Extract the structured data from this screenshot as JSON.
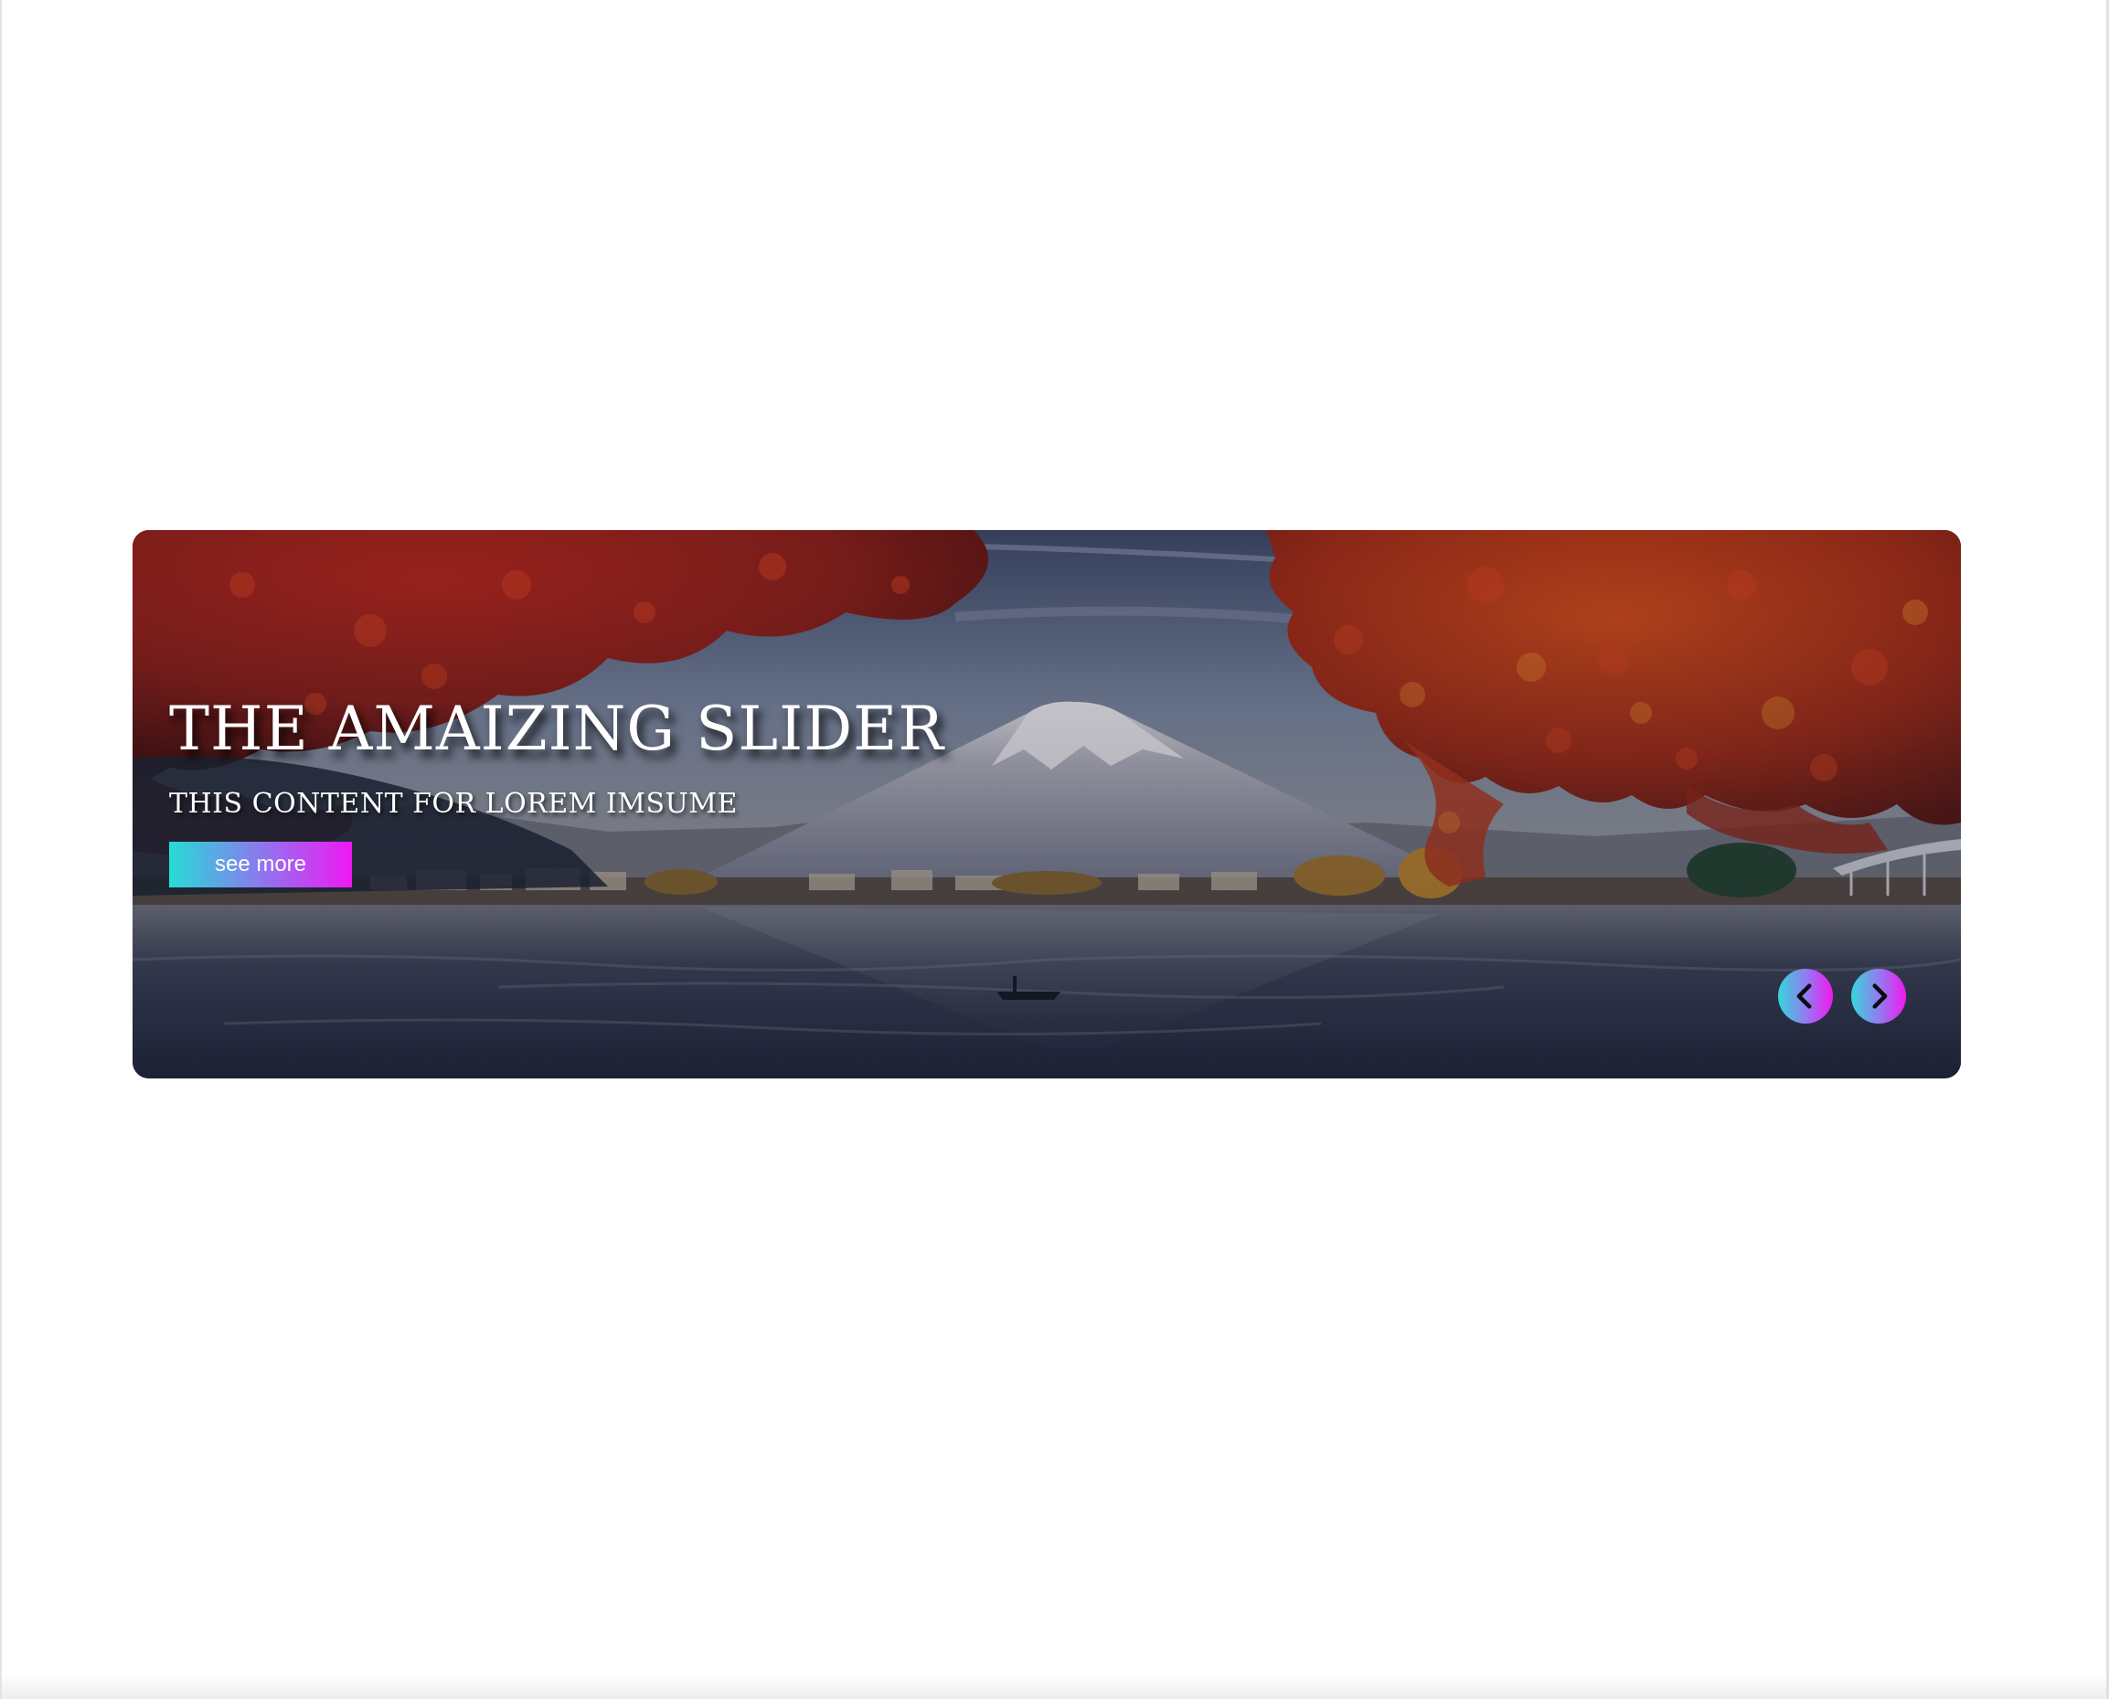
{
  "slider": {
    "title": "THE AMAIZING SLIDER",
    "subtitle": "THIS CONTENT FOR LOREM IMSUME",
    "cta_label": "see more",
    "image": "autumn lake mountain landscape",
    "prev_icon": "chevron-left-icon",
    "next_icon": "chevron-right-icon"
  },
  "colors": {
    "page_background": "#ffffff",
    "button_gradient_start": "#26dcd6",
    "button_gradient_end": "#ef19f3",
    "caption_text": "#ffffff"
  }
}
